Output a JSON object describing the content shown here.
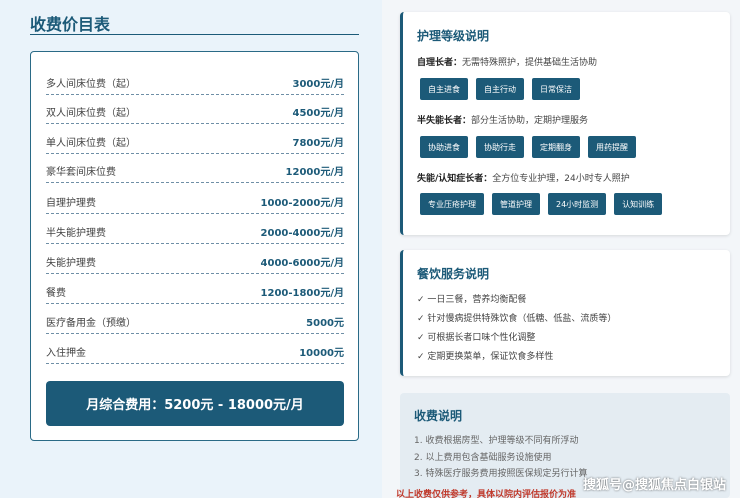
{
  "left": {
    "title": "收费价目表",
    "rows": [
      {
        "name": "多人间床位费（起）",
        "value": "3000元/月"
      },
      {
        "name": "双人间床位费（起）",
        "value": "4500元/月"
      },
      {
        "name": "单人间床位费（起）",
        "value": "7800元/月"
      },
      {
        "name": "豪华套间床位费",
        "value": "12000元/月"
      },
      {
        "name": "自理护理费",
        "value": "1000-2000元/月"
      },
      {
        "name": "半失能护理费",
        "value": "2000-4000元/月"
      },
      {
        "name": "失能护理费",
        "value": "4000-6000元/月"
      },
      {
        "name": "餐费",
        "value": "1200-1800元/月"
      },
      {
        "name": "医疗备用金（预缴）",
        "value": "5000元"
      },
      {
        "name": "入住押金",
        "value": "10000元"
      }
    ],
    "total": "月综合费用：5200元 - 18000元/月"
  },
  "care": {
    "title": "护理等级说明",
    "levels": [
      {
        "label": "自理长者：",
        "desc": "无需特殊照护，提供基础生活协助",
        "tags": [
          "自主进食",
          "自主行动",
          "日常保洁"
        ]
      },
      {
        "label": "半失能长者：",
        "desc": "部分生活协助，定期护理服务",
        "tags": [
          "协助进食",
          "协助行走",
          "定期翻身",
          "用药提醒"
        ]
      },
      {
        "label": "失能/认知症长者：",
        "desc": "全方位专业护理，24小时专人照护",
        "tags": [
          "专业压疮护理",
          "管道护理",
          "24小时监测",
          "认知训练"
        ]
      }
    ]
  },
  "meal": {
    "title": "餐饮服务说明",
    "items": [
      "✓ 一日三餐，营养均衡配餐",
      "✓ 针对慢病提供特殊饮食（低糖、低盐、流质等）",
      "✓ 可根据长者口味个性化调整",
      "✓ 定期更换菜单，保证饮食多样性"
    ]
  },
  "notes": {
    "title": "收费说明",
    "items": [
      "1. 收费根据房型、护理等级不同有所浮动",
      "2. 以上费用包含基础服务设施使用",
      "3. 特殊医疗服务费用按照医保规定另行计算"
    ],
    "warning": "以上收费仅供参考，具体以院内评估报价为准"
  },
  "watermark": "搜狐号@搜狐焦点白银站"
}
